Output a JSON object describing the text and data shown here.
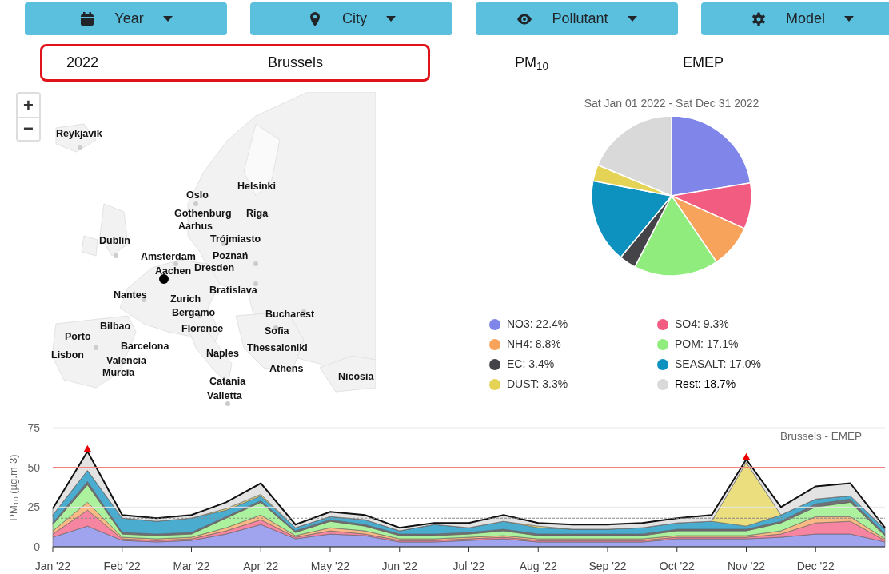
{
  "filters": [
    {
      "label": "Year"
    },
    {
      "label": "City"
    },
    {
      "label": "Pollutant"
    },
    {
      "label": "Model"
    }
  ],
  "selection": {
    "framed": [
      "2022",
      "Brussels"
    ],
    "values": [
      "PM$_{10}$",
      "EMEP"
    ]
  },
  "map": {
    "zoom_in": "+",
    "zoom_out": "−",
    "cities": [
      "Reykjavik",
      "Helsinki",
      "Oslo",
      "Gothenburg",
      "Riga",
      "Aarhus",
      "Trójmiasto",
      "Dublin",
      "Amsterdam",
      "Poznań",
      "Aachen",
      "Dresden",
      "Bratislava",
      "Nantes",
      "Zurich",
      "Bergamo",
      "Bucharest",
      "Bilbao",
      "Florence",
      "Sofia",
      "Porto",
      "Barcelona",
      "Thessaloniki",
      "Lisbon",
      "Naples",
      "Valencia",
      "Athens",
      "Murcia",
      "Nicosia",
      "Catania",
      "Valletta"
    ]
  },
  "pie": {
    "chart_data": {
      "type": "pie",
      "title": "Sat Jan 01 2022 - Sat Dec 31 2022",
      "values": [
        22.4,
        9.3,
        8.8,
        17.1,
        3.4,
        17.0,
        3.3,
        18.7
      ]
    },
    "legend": [
      {
        "label": "NO3: 22.4%",
        "color": "#8085e9",
        "hover": false
      },
      {
        "label": "SO4: 9.3%",
        "color": "#f15c80",
        "hover": false
      },
      {
        "label": "NH4: 8.8%",
        "color": "#f7a35c",
        "hover": false
      },
      {
        "label": "POM: 17.1%",
        "color": "#90ed7d",
        "hover": false
      },
      {
        "label": "EC: 3.4%",
        "color": "#434348",
        "hover": false
      },
      {
        "label": "SEASALT: 17.0%",
        "color": "#0d91bf",
        "hover": false
      },
      {
        "label": "DUST: 3.3%",
        "color": "#e4d354",
        "hover": false
      },
      {
        "label": "Rest: 18.7%",
        "color": "#d9d9d9",
        "hover": true
      }
    ]
  },
  "timeseries": {
    "chart_data": {
      "type": "area",
      "stacked": true,
      "title": "Brussels - EMEP",
      "ylabel": "PM$_{10}$ (µg.m-3)",
      "categories": [
        "Jan '22",
        null,
        "Feb '22",
        null,
        "Mar '22",
        null,
        "Apr '22",
        null,
        "May '22",
        null,
        "Jun '22",
        null,
        "Jul '22",
        null,
        "Aug '22",
        null,
        "Sep '22",
        null,
        "Oct '22",
        null,
        "Nov '22",
        null,
        "Dec '22",
        null,
        null
      ],
      "ylim": [
        0,
        75
      ],
      "yticks": [
        0,
        25,
        50,
        75
      ],
      "series": [
        {
          "color": "#8085e9",
          "values": [
            6,
            13,
            4,
            3,
            4,
            8,
            14,
            5,
            8,
            7,
            3,
            3,
            4,
            5,
            3,
            3,
            3,
            3,
            5,
            5,
            5,
            6,
            8,
            8,
            3
          ]
        },
        {
          "color": "#f15c80",
          "values": [
            2,
            10,
            1,
            1,
            1,
            2,
            3,
            1,
            2,
            1,
            1,
            1,
            1,
            1,
            1,
            1,
            1,
            1,
            1,
            1,
            1,
            2,
            7,
            8,
            1
          ]
        },
        {
          "color": "#f7a35c",
          "values": [
            2,
            5,
            1,
            1,
            1,
            2,
            3,
            1,
            2,
            2,
            1,
            1,
            1,
            1,
            1,
            1,
            1,
            1,
            1,
            1,
            1,
            2,
            4,
            3,
            1
          ]
        },
        {
          "color": "#90ed7d",
          "values": [
            4,
            11,
            2,
            2,
            2,
            6,
            8,
            2,
            4,
            3,
            2,
            2,
            2,
            3,
            2,
            2,
            2,
            2,
            3,
            3,
            3,
            5,
            6,
            9,
            2
          ]
        },
        {
          "color": "#434348",
          "values": [
            1,
            2,
            1,
            1,
            1,
            1,
            1,
            1,
            1,
            1,
            1,
            1,
            1,
            1,
            1,
            1,
            1,
            1,
            1,
            1,
            1,
            1,
            2,
            2,
            1
          ]
        },
        {
          "color": "#0d91bf",
          "values": [
            5,
            7,
            9,
            8,
            9,
            4,
            3,
            2,
            2,
            3,
            2,
            6,
            3,
            5,
            4,
            3,
            3,
            4,
            4,
            5,
            2,
            4,
            3,
            2,
            3
          ]
        },
        {
          "color": "#e4d354",
          "values": [
            0,
            0,
            0,
            0,
            0,
            1,
            1,
            0,
            0,
            0,
            0,
            0,
            0,
            0,
            1,
            0,
            0,
            0,
            0,
            0,
            40,
            0,
            0,
            0,
            0
          ]
        },
        {
          "color": "#d9d9d9",
          "values": [
            4,
            12,
            2,
            2,
            2,
            4,
            7,
            2,
            3,
            3,
            2,
            1,
            3,
            4,
            2,
            3,
            3,
            3,
            3,
            4,
            2,
            5,
            8,
            8,
            1
          ]
        }
      ],
      "ref_lines": [
        {
          "axis": "y",
          "value": 50
        },
        {
          "axis": "y",
          "value": 18
        }
      ]
    }
  }
}
